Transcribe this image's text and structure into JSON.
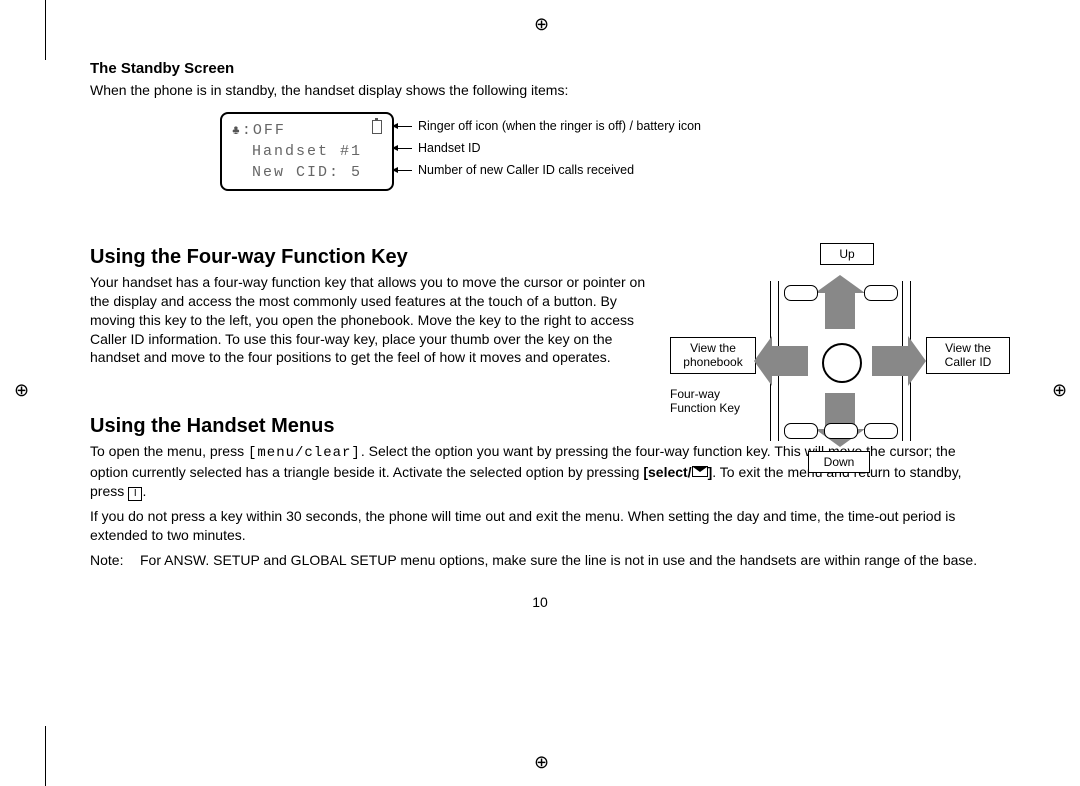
{
  "section_standby": {
    "heading": "The Standby Screen",
    "intro": "When the phone is in standby, the handset display shows the following items:",
    "lcd": {
      "ringer_off": ":OFF",
      "handset_id": "Handset #1",
      "new_cid": "New CID: 5"
    },
    "callouts": {
      "row1": "Ringer off icon (when the ringer is off) / battery icon",
      "row2": "Handset ID",
      "row3": "Number of new Caller ID calls received"
    }
  },
  "section_fourway": {
    "heading": "Using the Four-way Function Key",
    "body": "Your handset has a four-way function key that allows you to move the cursor or pointer on the display and access the most commonly used features at the touch of a button. By moving this key to the left, you open the phonebook. Move the key to the right to access Caller ID information. To use this four-way key, place your thumb over the key on the handset and move to the four positions to get the feel of how it moves and operates.",
    "labels": {
      "up": "Up",
      "down": "Down",
      "left": "View the\nphonebook",
      "right": "View the\nCaller ID",
      "funckey": "Four-way\nFunction Key"
    }
  },
  "section_menus": {
    "heading": "Using the Handset Menus",
    "p1a": "To open the menu, press ",
    "menu_clear": "[menu/clear]",
    "p1b": ". Select the option you want by pressing the four-way function key. This will move the cursor; the option currently selected has a triangle beside it. Activate the selected option by pressing ",
    "select_label": "[select/",
    "p1c": ". To exit the menu and return to standby, press ",
    "p1d": ".",
    "p2": "If you do not press a key within 30 seconds, the phone will time out and exit the menu. When setting the day and time, the time-out period is extended to two minutes.",
    "note_label": "Note:",
    "note_body": "For ANSW. SETUP and GLOBAL SETUP menu options, make sure the line is not in use and the handsets are within range of the base."
  },
  "page_number": "10"
}
